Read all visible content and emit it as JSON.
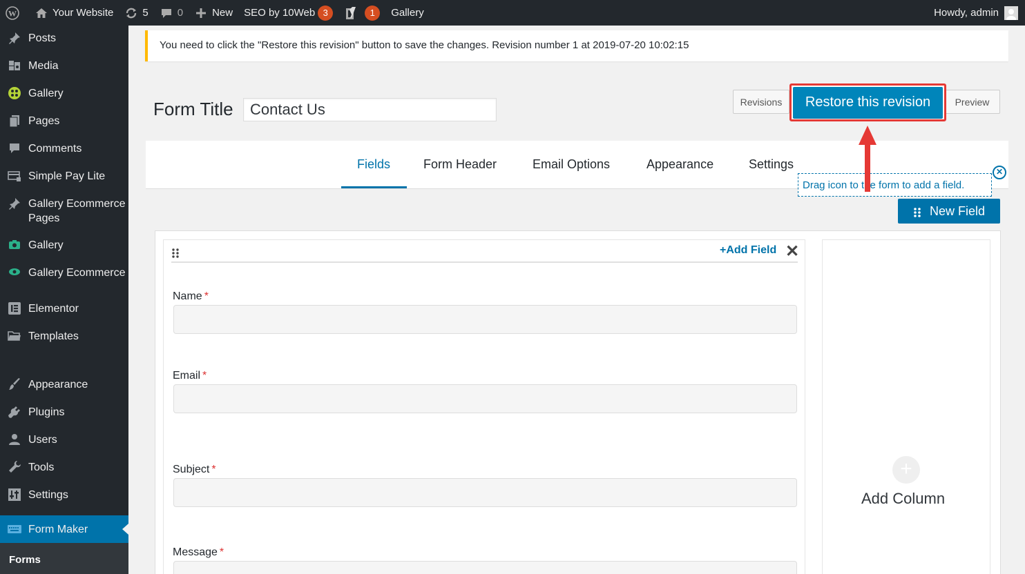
{
  "adminbar": {
    "site_name": "Your Website",
    "updates_count": "5",
    "comments_count": "0",
    "new_label": "New",
    "seo_label": "SEO by 10Web",
    "seo_badge": "3",
    "yoast_badge": "1",
    "gallery_label": "Gallery",
    "howdy": "Howdy, admin"
  },
  "sidebar": {
    "items": [
      {
        "label": "Posts",
        "icon": "pin-icon"
      },
      {
        "label": "Media",
        "icon": "media-icon"
      },
      {
        "label": "Gallery",
        "icon": "gallery-icon"
      },
      {
        "label": "Pages",
        "icon": "pages-icon"
      },
      {
        "label": "Comments",
        "icon": "comment-icon"
      },
      {
        "label": "Simple Pay Lite",
        "icon": "card-icon"
      },
      {
        "label": "Gallery Ecommerce Pages",
        "icon": "pin-icon"
      },
      {
        "label": "Gallery",
        "icon": "camera-icon"
      },
      {
        "label": "Gallery Ecommerce",
        "icon": "eye-icon"
      },
      {
        "label": "Elementor",
        "icon": "elementor-icon"
      },
      {
        "label": "Templates",
        "icon": "folder-icon"
      },
      {
        "label": "Appearance",
        "icon": "brush-icon"
      },
      {
        "label": "Plugins",
        "icon": "plug-icon"
      },
      {
        "label": "Users",
        "icon": "user-icon"
      },
      {
        "label": "Tools",
        "icon": "wrench-icon"
      },
      {
        "label": "Settings",
        "icon": "settings-icon"
      },
      {
        "label": "Form Maker",
        "icon": "keyboard-icon"
      }
    ],
    "submenu_forms": "Forms"
  },
  "notice": {
    "text": "You need to click the \"Restore this revision\" button to save the changes. Revision number 1 at 2019-07-20 10:02:15"
  },
  "form": {
    "title_label": "Form Title",
    "title_value": "Contact Us",
    "revisions_label": "Revisions",
    "restore_label": "Restore this revision",
    "preview_label": "Preview"
  },
  "tabs": [
    {
      "label": "Fields",
      "active": true
    },
    {
      "label": "Form Header",
      "active": false
    },
    {
      "label": "Email Options",
      "active": false
    },
    {
      "label": "Appearance",
      "active": false
    },
    {
      "label": "Settings",
      "active": false
    }
  ],
  "tooltip": {
    "text": "Drag icon to the form to add a field."
  },
  "new_field_label": "New Field",
  "column": {
    "add_field_label": "Add Field",
    "fields": [
      {
        "label": "Name",
        "required": "*"
      },
      {
        "label": "Email",
        "required": "*"
      },
      {
        "label": "Subject",
        "required": "*"
      },
      {
        "label": "Message",
        "required": "*"
      }
    ]
  },
  "add_column_label": "Add Column",
  "colors": {
    "admin_bg": "#23282d",
    "accent": "#0073aa",
    "highlight": "#e53935",
    "notice_border": "#ffb900"
  }
}
